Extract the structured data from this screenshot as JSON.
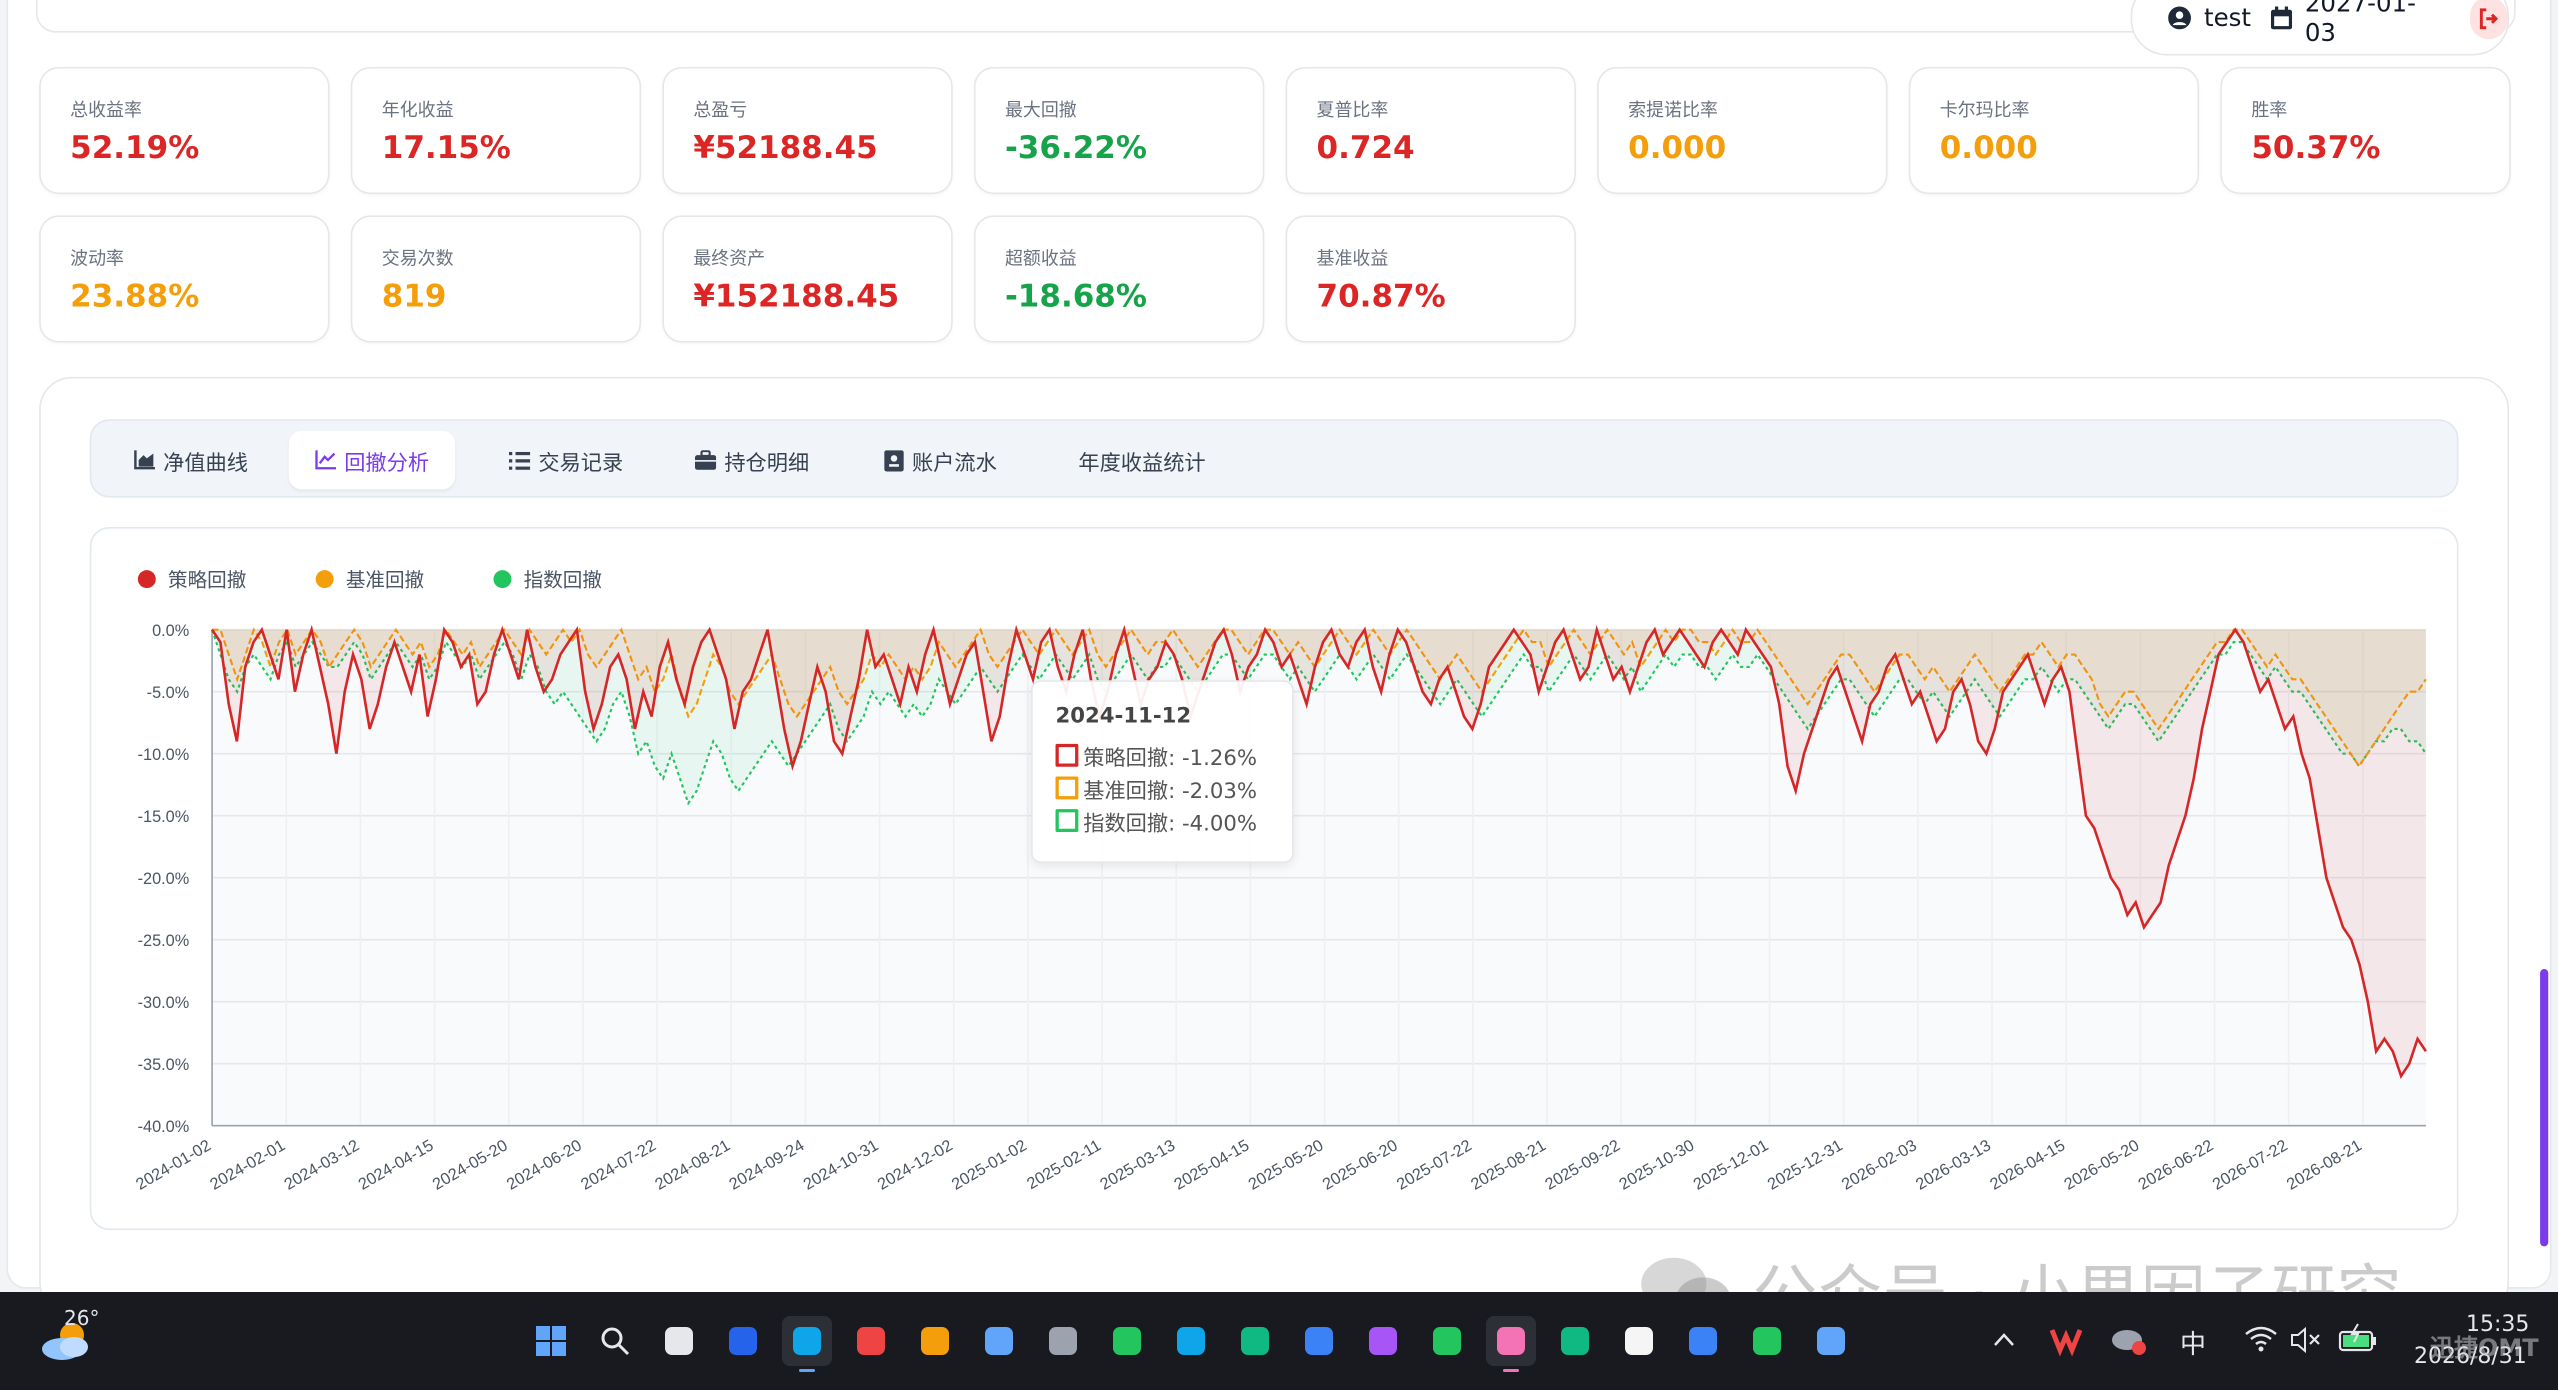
{
  "header": {
    "user": "test",
    "date": "2027-01-03",
    "nav_colors": [
      "#8b5cf6",
      "#10b981",
      "#67e8f9",
      "#f59e0b",
      "#f472b6",
      "#a78bfa",
      "#f9a8d4"
    ]
  },
  "metrics": [
    {
      "label": "总收益率",
      "value": "52.19%",
      "color": "#dc2626"
    },
    {
      "label": "年化收益",
      "value": "17.15%",
      "color": "#dc2626"
    },
    {
      "label": "总盈亏",
      "value": "¥52188.45",
      "color": "#dc2626"
    },
    {
      "label": "最大回撤",
      "value": "-36.22%",
      "color": "#16a34a"
    },
    {
      "label": "夏普比率",
      "value": "0.724",
      "color": "#dc2626"
    },
    {
      "label": "索提诺比率",
      "value": "0.000",
      "color": "#f59e0b"
    },
    {
      "label": "卡尔玛比率",
      "value": "0.000",
      "color": "#f59e0b"
    },
    {
      "label": "胜率",
      "value": "50.37%",
      "color": "#dc2626"
    },
    {
      "label": "波动率",
      "value": "23.88%",
      "color": "#f59e0b"
    },
    {
      "label": "交易次数",
      "value": "819",
      "color": "#f59e0b"
    },
    {
      "label": "最终资产",
      "value": "¥152188.45",
      "color": "#dc2626"
    },
    {
      "label": "超额收益",
      "value": "-18.68%",
      "color": "#16a34a"
    },
    {
      "label": "基准收益",
      "value": "70.87%",
      "color": "#dc2626"
    }
  ],
  "tabs": [
    {
      "label": "净值曲线",
      "icon": "area-chart-icon",
      "active": false
    },
    {
      "label": "回撤分析",
      "icon": "line-chart-icon",
      "active": true
    },
    {
      "label": "交易记录",
      "icon": "list-icon",
      "active": false
    },
    {
      "label": "持仓明细",
      "icon": "briefcase-icon",
      "active": false
    },
    {
      "label": "账户流水",
      "icon": "ledger-icon",
      "active": false
    },
    {
      "label": "年度收益统计",
      "icon": "",
      "active": false
    }
  ],
  "chart_data": {
    "type": "area",
    "legend_position": "top-left",
    "grid": true,
    "ylim": [
      -40,
      0
    ],
    "y_ticks": [
      "0.0%",
      "-5.0%",
      "-10.0%",
      "-15.0%",
      "-20.0%",
      "-25.0%",
      "-30.0%",
      "-35.0%",
      "-40.0%"
    ],
    "x_ticks": [
      "2024-01-02",
      "2024-02-01",
      "2024-03-12",
      "2024-04-15",
      "2024-05-20",
      "2024-06-20",
      "2024-07-22",
      "2024-08-21",
      "2024-09-24",
      "2024-10-31",
      "2024-12-02",
      "2025-01-02",
      "2025-02-11",
      "2025-03-13",
      "2025-04-15",
      "2025-05-20",
      "2025-06-20",
      "2025-07-22",
      "2025-08-21",
      "2025-09-22",
      "2025-10-30",
      "2025-12-01",
      "2025-12-31",
      "2026-02-03",
      "2026-03-13",
      "2026-04-15",
      "2026-05-20",
      "2026-06-22",
      "2026-07-22",
      "2026-08-21"
    ],
    "series": [
      {
        "name": "策略回撤",
        "color": "#d62728",
        "style": "solid",
        "values": [
          0,
          -1,
          -6,
          -9,
          -3,
          -1,
          0,
          -2,
          -4,
          0,
          -5,
          -2,
          0,
          -3,
          -6,
          -10,
          -5,
          -2,
          -4,
          -8,
          -6,
          -3,
          -1,
          -3,
          -5,
          -2,
          -7,
          -4,
          0,
          -1,
          -3,
          -2,
          -6,
          -5,
          -2,
          0,
          -2,
          -4,
          0,
          -3,
          -5,
          -4,
          -2,
          -1,
          0,
          -5,
          -8,
          -6,
          -3,
          -2,
          -4,
          -8,
          -5,
          -7,
          -3,
          -1,
          -4,
          -6,
          -3,
          -1,
          0,
          -2,
          -4,
          -8,
          -5,
          -4,
          -2,
          0,
          -4,
          -8,
          -11,
          -9,
          -6,
          -3,
          -5,
          -9,
          -10,
          -7,
          -4,
          0,
          -3,
          -2,
          -4,
          -6,
          -3,
          -5,
          -2,
          0,
          -3,
          -6,
          -4,
          -2,
          -1,
          -5,
          -9,
          -7,
          -3,
          0,
          -2,
          -4,
          -1,
          0,
          -3,
          -5,
          -2,
          0,
          -4,
          -7,
          -5,
          -2,
          0,
          -3,
          -6,
          -4,
          -3,
          -1,
          -2,
          -4,
          -7,
          -5,
          -3,
          -1,
          0,
          -2,
          -5,
          -3,
          -2,
          0,
          -1,
          -3,
          -2,
          -4,
          -6,
          -3,
          -1,
          0,
          -2,
          -3,
          -1,
          0,
          -3,
          -5,
          -2,
          0,
          -1,
          -3,
          -5,
          -6,
          -4,
          -3,
          -5,
          -7,
          -8,
          -6,
          -3,
          -2,
          -1,
          0,
          -1,
          -2,
          -5,
          -3,
          -1,
          0,
          -2,
          -4,
          -3,
          0,
          -2,
          -4,
          -3,
          -5,
          -3,
          -1,
          0,
          -2,
          -1,
          0,
          -1,
          -2,
          -3,
          -1,
          0,
          -1,
          -2,
          0,
          -1,
          -2,
          -3,
          -6,
          -11,
          -13,
          -10,
          -8,
          -6,
          -4,
          -3,
          -5,
          -7,
          -9,
          -6,
          -5,
          -3,
          -2,
          -4,
          -6,
          -5,
          -7,
          -9,
          -8,
          -5,
          -4,
          -6,
          -9,
          -10,
          -8,
          -5,
          -4,
          -3,
          -2,
          -4,
          -6,
          -4,
          -3,
          -5,
          -10,
          -15,
          -16,
          -18,
          -20,
          -21,
          -23,
          -22,
          -24,
          -23,
          -22,
          -19,
          -17,
          -15,
          -12,
          -8,
          -5,
          -2,
          -1,
          0,
          -1,
          -3,
          -5,
          -4,
          -6,
          -8,
          -7,
          -10,
          -12,
          -16,
          -20,
          -22,
          -24,
          -25,
          -27,
          -30,
          -34,
          -33,
          -34,
          -36,
          -35,
          -33,
          -34
        ]
      },
      {
        "name": "基准回撤",
        "color": "#f59e0b",
        "style": "dashed",
        "values": [
          0,
          0,
          -2,
          -4,
          -2,
          0,
          -1,
          -3,
          -1,
          0,
          -2,
          -1,
          0,
          -1,
          -3,
          -2,
          -1,
          0,
          -1,
          -3,
          -2,
          -1,
          0,
          -1,
          -2,
          -1,
          -3,
          -2,
          0,
          -1,
          -2,
          -1,
          -3,
          -2,
          -1,
          0,
          -1,
          -2,
          0,
          -1,
          -2,
          -1,
          0,
          -1,
          0,
          -2,
          -3,
          -2,
          -1,
          0,
          -2,
          -4,
          -3,
          -5,
          -4,
          -2,
          -5,
          -7,
          -6,
          -4,
          -2,
          -3,
          -5,
          -6,
          -5,
          -4,
          -3,
          -2,
          -4,
          -6,
          -7,
          -6,
          -5,
          -4,
          -3,
          -5,
          -6,
          -5,
          -4,
          -2,
          -3,
          -2,
          -3,
          -4,
          -3,
          -4,
          -3,
          -1,
          -2,
          -3,
          -2,
          -1,
          0,
          -2,
          -3,
          -2,
          -1,
          0,
          -1,
          -2,
          -1,
          0,
          -1,
          -2,
          -1,
          0,
          -2,
          -3,
          -2,
          -1,
          0,
          -1,
          -2,
          -1,
          -1,
          0,
          -1,
          -2,
          -3,
          -2,
          -1,
          0,
          0,
          -1,
          -2,
          -1,
          0,
          0,
          -1,
          -2,
          -1,
          -2,
          -3,
          -2,
          -1,
          0,
          -1,
          -2,
          -1,
          0,
          -1,
          -2,
          -1,
          0,
          -1,
          -2,
          -3,
          -4,
          -3,
          -2,
          -3,
          -4,
          -5,
          -4,
          -3,
          -2,
          -1,
          0,
          -1,
          -1,
          -3,
          -2,
          -1,
          0,
          -1,
          -2,
          -1,
          0,
          -1,
          -2,
          -1,
          -3,
          -2,
          -1,
          0,
          -1,
          0,
          0,
          -1,
          -1,
          -2,
          -1,
          0,
          -1,
          -1,
          0,
          -1,
          -2,
          -3,
          -4,
          -5,
          -6,
          -5,
          -4,
          -3,
          -2,
          -2,
          -3,
          -4,
          -5,
          -4,
          -3,
          -2,
          -2,
          -3,
          -4,
          -3,
          -4,
          -5,
          -4,
          -3,
          -2,
          -3,
          -4,
          -5,
          -4,
          -3,
          -2,
          -2,
          -1,
          -2,
          -3,
          -2,
          -2,
          -3,
          -4,
          -6,
          -7,
          -6,
          -5,
          -5,
          -6,
          -7,
          -8,
          -7,
          -6,
          -5,
          -4,
          -3,
          -2,
          -1,
          -1,
          0,
          0,
          -1,
          -2,
          -3,
          -2,
          -3,
          -4,
          -4,
          -5,
          -6,
          -7,
          -8,
          -9,
          -10,
          -11,
          -10,
          -9,
          -8,
          -7,
          -6,
          -5,
          -5,
          -4
        ]
      },
      {
        "name": "指数回撤",
        "color": "#22c55e",
        "style": "dotted",
        "values": [
          0,
          -2,
          -4,
          -5,
          -3,
          -2,
          -3,
          -4,
          -2,
          -1,
          -3,
          -2,
          -1,
          -2,
          -3,
          -3,
          -2,
          -1,
          -2,
          -4,
          -3,
          -2,
          -1,
          -2,
          -3,
          -2,
          -4,
          -3,
          -1,
          -2,
          -3,
          -2,
          -4,
          -3,
          -2,
          -1,
          -2,
          -4,
          -2,
          -3,
          -5,
          -6,
          -5,
          -6,
          -7,
          -8,
          -9,
          -8,
          -6,
          -5,
          -7,
          -10,
          -9,
          -11,
          -12,
          -10,
          -12,
          -14,
          -13,
          -11,
          -9,
          -10,
          -12,
          -13,
          -12,
          -11,
          -10,
          -9,
          -10,
          -11,
          -10,
          -9,
          -8,
          -7,
          -6,
          -8,
          -9,
          -8,
          -7,
          -5,
          -6,
          -5,
          -6,
          -7,
          -6,
          -7,
          -6,
          -4,
          -5,
          -6,
          -5,
          -4,
          -3,
          -4,
          -5,
          -4,
          -3,
          -2,
          -3,
          -4,
          -3,
          -2,
          -3,
          -4,
          -3,
          -2,
          -4,
          -5,
          -4,
          -3,
          -2,
          -3,
          -4,
          -3,
          -3,
          -2,
          -3,
          -4,
          -5,
          -4,
          -3,
          -2,
          -2,
          -3,
          -4,
          -3,
          -2,
          -2,
          -3,
          -4,
          -3,
          -4,
          -5,
          -4,
          -3,
          -2,
          -3,
          -4,
          -3,
          -2,
          -3,
          -4,
          -3,
          -2,
          -3,
          -4,
          -5,
          -6,
          -5,
          -4,
          -5,
          -6,
          -7,
          -6,
          -5,
          -4,
          -3,
          -2,
          -3,
          -3,
          -5,
          -4,
          -3,
          -2,
          -3,
          -4,
          -3,
          -2,
          -3,
          -4,
          -3,
          -5,
          -4,
          -3,
          -2,
          -3,
          -2,
          -2,
          -3,
          -3,
          -4,
          -3,
          -2,
          -3,
          -3,
          -2,
          -3,
          -4,
          -5,
          -6,
          -7,
          -8,
          -7,
          -6,
          -5,
          -4,
          -4,
          -5,
          -6,
          -7,
          -6,
          -5,
          -4,
          -4,
          -5,
          -6,
          -5,
          -6,
          -7,
          -6,
          -5,
          -4,
          -5,
          -6,
          -7,
          -6,
          -5,
          -4,
          -4,
          -3,
          -4,
          -5,
          -4,
          -4,
          -5,
          -6,
          -7,
          -8,
          -7,
          -6,
          -6,
          -7,
          -8,
          -9,
          -8,
          -7,
          -6,
          -5,
          -4,
          -3,
          -2,
          -2,
          -1,
          -1,
          -2,
          -3,
          -4,
          -3,
          -4,
          -5,
          -5,
          -6,
          -7,
          -8,
          -9,
          -10,
          -10,
          -11,
          -10,
          -9,
          -9,
          -8,
          -8,
          -9,
          -9,
          -10
        ]
      }
    ],
    "tooltip": {
      "date": "2024-11-12",
      "rows": [
        "策略回撤: -1.26%",
        "基准回撤: -2.03%",
        "指数回撤: -4.00%"
      ]
    }
  },
  "watermark": "公众号 · 小果因子研究",
  "taskbar": {
    "weather_temp": "26°",
    "ime": "中",
    "time": "15:35",
    "date": "2026/8/31",
    "watermark2": "迅捷OMT",
    "icons": [
      "windows-start-icon",
      "search-icon",
      "task-view-icon",
      "outlook-icon",
      "edge-icon",
      "wps-icon",
      "file-explorer-icon",
      "store-icon",
      "app-icon",
      "map-icon",
      "edge-dev-icon",
      "mail-icon",
      "translate-icon",
      "mindmap-icon",
      "chat-icon",
      "screenshot-icon",
      "sheets-icon",
      "panda-icon",
      "vscode-icon",
      "wechat-icon",
      "notepad-icon"
    ]
  }
}
